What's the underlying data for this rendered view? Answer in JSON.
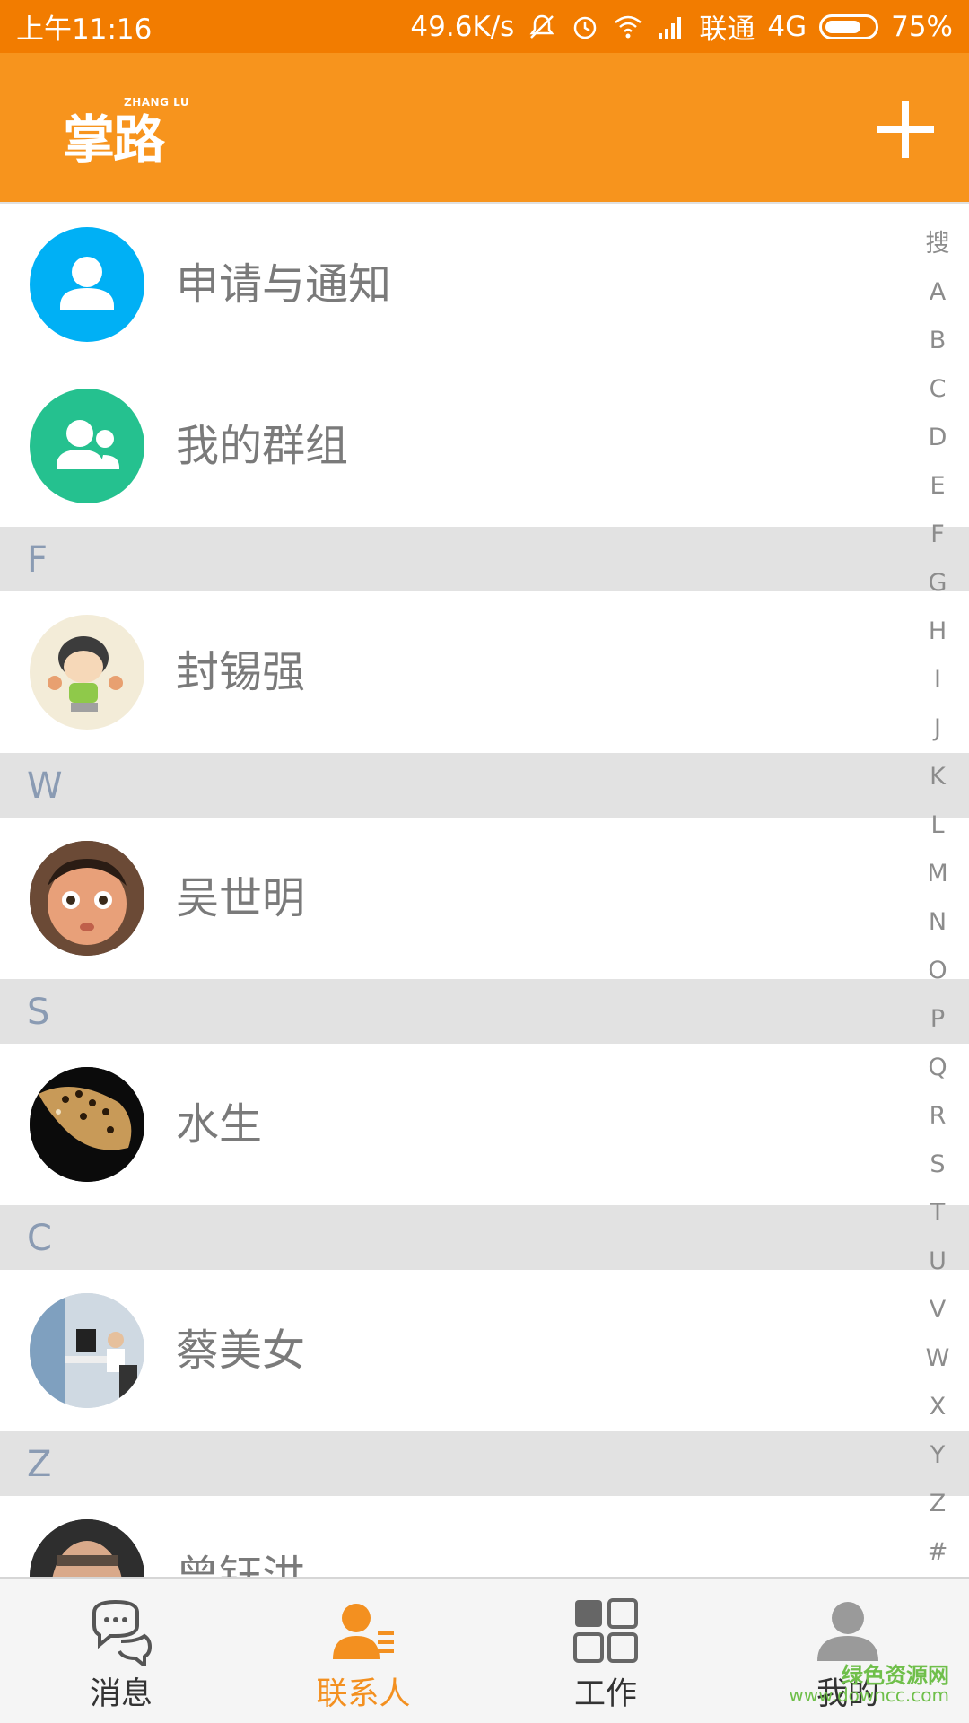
{
  "status_bar": {
    "time": "上午11:16",
    "speed": "49.6K/s",
    "carrier": "联通",
    "network": "4G",
    "battery": "75%",
    "battery_level": 0.75
  },
  "app_bar": {
    "logo_text": "掌路",
    "logo_sub": "ZHANG LU",
    "add_icon": "plus-icon"
  },
  "top_items": [
    {
      "label": "申请与通知",
      "icon": "person-icon",
      "color": "#00b0f5"
    },
    {
      "label": "我的群组",
      "icon": "group-icon",
      "color": "#25c18f"
    }
  ],
  "sections": [
    {
      "letter": "F",
      "contacts": [
        {
          "name": "封锡强"
        }
      ]
    },
    {
      "letter": "W",
      "contacts": [
        {
          "name": "吴世明"
        }
      ]
    },
    {
      "letter": "S",
      "contacts": [
        {
          "name": "水生"
        }
      ]
    },
    {
      "letter": "C",
      "contacts": [
        {
          "name": "蔡美女"
        }
      ]
    },
    {
      "letter": "Z",
      "contacts": [
        {
          "name": "曾钰洪"
        }
      ]
    }
  ],
  "index_letters": [
    "搜",
    "A",
    "B",
    "C",
    "D",
    "E",
    "F",
    "G",
    "H",
    "I",
    "J",
    "K",
    "L",
    "M",
    "N",
    "O",
    "P",
    "Q",
    "R",
    "S",
    "T",
    "U",
    "V",
    "W",
    "X",
    "Y",
    "Z",
    "#"
  ],
  "bottom_nav": [
    {
      "label": "消息",
      "icon": "chat-icon",
      "active": false
    },
    {
      "label": "联系人",
      "icon": "contacts-icon",
      "active": true
    },
    {
      "label": "工作",
      "icon": "grid-icon",
      "active": false
    },
    {
      "label": "我的",
      "icon": "profile-icon",
      "active": false
    }
  ],
  "watermark": {
    "line1": "绿色资源网",
    "line2": "www.downcc.com"
  },
  "colors": {
    "accent": "#f7941d",
    "statusbar": "#f27c00",
    "nav_active": "#f39020"
  }
}
